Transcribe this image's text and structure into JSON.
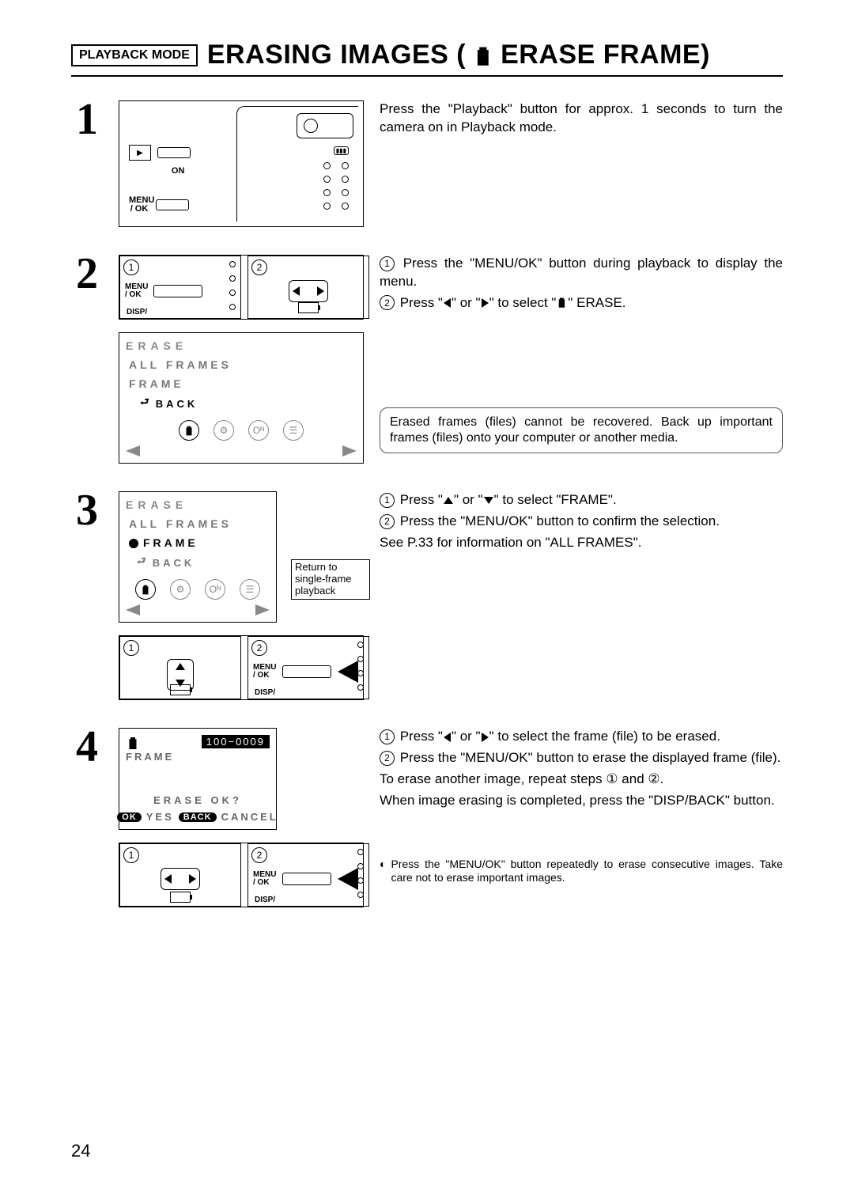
{
  "page_number": "24",
  "header": {
    "mode_badge": "PLAYBACK MODE",
    "title_a": "ERASING IMAGES (",
    "title_b": " ERASE FRAME)"
  },
  "steps": {
    "s1": {
      "num": "1",
      "text": "Press the \"Playback\" button for approx. 1 seconds to turn the camera on in Playback mode.",
      "diagram": {
        "play_lbl": "▶",
        "on_lbl": "ON",
        "menu_lbl_a": "MENU",
        "menu_lbl_b": "/ OK"
      }
    },
    "s2": {
      "num": "2",
      "line1": "Press the \"MENU/OK\" button during playback to display the menu.",
      "line2_a": "Press \"",
      "line2_b": "\" or \"",
      "line2_c": "\" to select \"",
      "line2_d": "\" ERASE.",
      "warn": "Erased frames (files) cannot be recovered. Back up important frames (files) onto your computer or another media.",
      "lcd": {
        "title": "ERASE",
        "opt_all": "ALL FRAMES",
        "opt_frame": "FRAME",
        "opt_back": "BACK"
      },
      "diagram": {
        "menu_lbl_a": "MENU",
        "menu_lbl_b": "/ OK",
        "disp_lbl": "DISP/"
      }
    },
    "s3": {
      "num": "3",
      "line1_a": "Press \"",
      "line1_b": "\" or \"",
      "line1_c": "\" to select \"FRAME\".",
      "line2": "Press the \"MENU/OK\" button to confirm the selection.",
      "line3": "See P.33 for information on \"ALL FRAMES\".",
      "callout": "Return to single-frame playback",
      "lcd": {
        "title": "ERASE",
        "opt_all": "ALL FRAMES",
        "opt_frame": "FRAME",
        "opt_back": "BACK"
      },
      "diagram": {
        "menu_lbl_a": "MENU",
        "menu_lbl_b": "/ OK",
        "disp_lbl": "DISP/"
      }
    },
    "s4": {
      "num": "4",
      "line1_a": "Press \"",
      "line1_b": "\" or \"",
      "line1_c": "\" to select the frame (file) to be erased.",
      "line2": "Press the \"MENU/OK\" button to erase the displayed frame (file).",
      "line3": "To erase another image, repeat steps ① and ②.",
      "line4": "When image erasing is completed, press the \"DISP/BACK\" button.",
      "note": "Press the \"MENU/OK\" button repeatedly to erase consecutive images. Take care not to erase important images.",
      "lcd": {
        "file_no": "100−0009",
        "frame_lbl": "FRAME",
        "ask": "ERASE OK?",
        "ok": "OK",
        "yes": "YES",
        "back": "BACK",
        "cancel": "CANCEL"
      },
      "diagram": {
        "menu_lbl_a": "MENU",
        "menu_lbl_b": "/ OK",
        "disp_lbl": "DISP/"
      }
    }
  }
}
